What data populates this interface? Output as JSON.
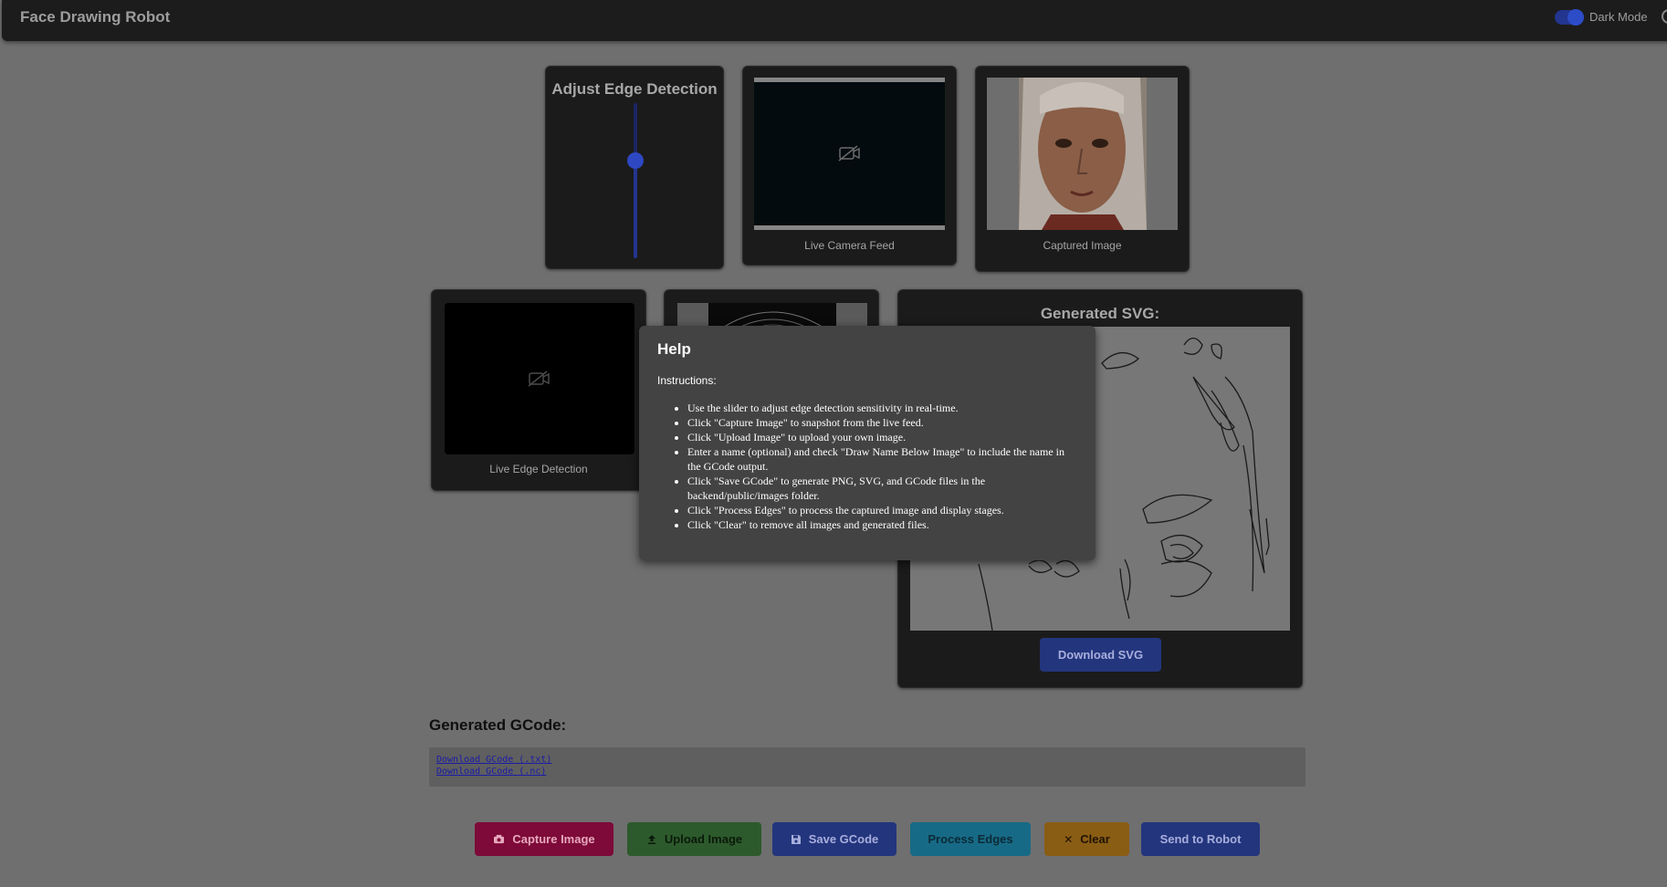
{
  "app": {
    "title": "Face Drawing Robot",
    "dark_mode_label": "Dark Mode",
    "dark_mode_on": true
  },
  "slider_card": {
    "title": "Adjust Edge Detection",
    "value_fraction": 0.63
  },
  "camera_card": {
    "caption": "Live Camera Feed"
  },
  "captured_card": {
    "caption": "Captured Image"
  },
  "edge_card": {
    "caption": "Live Edge Detection"
  },
  "svg_card": {
    "title": "Generated SVG:",
    "download_label": "Download SVG"
  },
  "gcode": {
    "title": "Generated GCode:",
    "links": [
      "Download GCode (.txt)",
      "Download GCode (.nc)"
    ]
  },
  "actions": [
    {
      "label": "Capture Image",
      "icon": "camera-icon",
      "color": "#7d0a38",
      "text": "#e8a7bd"
    },
    {
      "label": "Upload Image",
      "icon": "upload-icon",
      "color": "#2d5a2c",
      "text": "#0a1a0a"
    },
    {
      "label": "Save GCode",
      "icon": "save-icon",
      "color": "#23357d",
      "text": "#a8aedc"
    },
    {
      "label": "Process Edges",
      "icon": "",
      "color": "#176a86",
      "text": "#0b2b37"
    },
    {
      "label": "Clear",
      "icon": "close-icon",
      "color": "#8a5d14",
      "text": "#201305"
    },
    {
      "label": "Send to Robot",
      "icon": "",
      "color": "#23357d",
      "text": "#a8aedc"
    }
  ],
  "help": {
    "title": "Help",
    "subtitle": "Instructions:",
    "items": [
      "Use the slider to adjust edge detection sensitivity in real-time.",
      "Click \"Capture Image\" to snapshot from the live feed.",
      "Click \"Upload Image\" to upload your own image.",
      "Enter a name (optional) and check \"Draw Name Below Image\" to include the name in the GCode output.",
      "Click \"Save GCode\" to generate PNG, SVG, and GCode files in the backend/public/images folder.",
      "Click \"Process Edges\" to process the captured image and display stages.",
      "Click \"Clear\" to remove all images and generated files."
    ]
  }
}
